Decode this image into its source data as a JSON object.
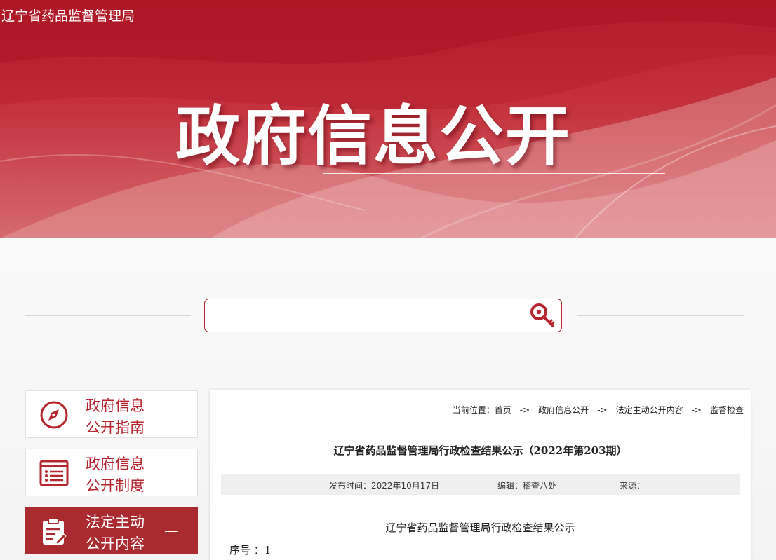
{
  "header": {
    "site_name": "辽宁省药品监督管理局",
    "banner_title": "政府信息公开"
  },
  "search": {
    "placeholder": "",
    "button_icon": "search-key-icon"
  },
  "sidebar": {
    "items": [
      {
        "label_line1": "政府信息",
        "label_line2": "公开指南",
        "icon": "compass-icon",
        "active": false
      },
      {
        "label_line1": "政府信息",
        "label_line2": "公开制度",
        "icon": "list-icon",
        "active": false
      },
      {
        "label_line1": "法定主动",
        "label_line2": "公开内容",
        "icon": "clipboard-edit-icon",
        "active": true,
        "expand_symbol": "—"
      }
    ]
  },
  "breadcrumb": {
    "prefix": "当前位置：",
    "items": [
      "首页",
      "政府信息公开",
      "法定主动公开内容",
      "监督检查"
    ],
    "separator": "->"
  },
  "article": {
    "title": "辽宁省药品监督管理局行政检查结果公示（2022年第203期）",
    "publish_time": "发布时间：2022年10月17日",
    "editor": "编辑：稽查八处",
    "source": "来源：",
    "doc_heading": "辽宁省药品监督管理局行政检查结果公示",
    "seq_label": "序号 ：1"
  },
  "colors": {
    "brand_red": "#b5252e",
    "active_red": "#a92a2f"
  }
}
